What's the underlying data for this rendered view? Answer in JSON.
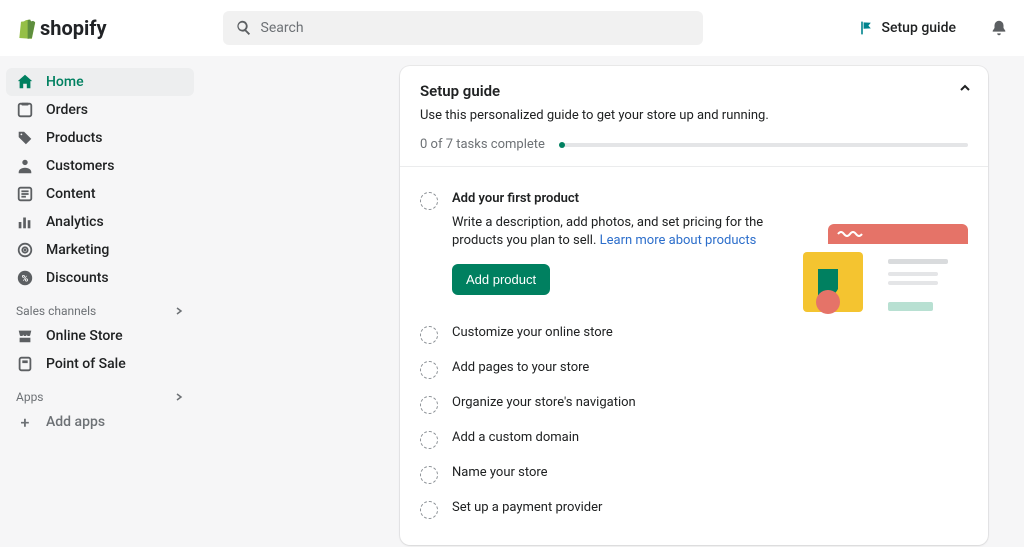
{
  "brand": "shopify",
  "search": {
    "placeholder": "Search"
  },
  "header_actions": {
    "setup_guide": "Setup guide"
  },
  "sidebar": {
    "items": [
      {
        "label": "Home"
      },
      {
        "label": "Orders"
      },
      {
        "label": "Products"
      },
      {
        "label": "Customers"
      },
      {
        "label": "Content"
      },
      {
        "label": "Analytics"
      },
      {
        "label": "Marketing"
      },
      {
        "label": "Discounts"
      }
    ],
    "sales_channels_label": "Sales channels",
    "sales_channels": [
      {
        "label": "Online Store"
      },
      {
        "label": "Point of Sale"
      }
    ],
    "apps_label": "Apps",
    "add_apps": "Add apps"
  },
  "guide": {
    "title": "Setup guide",
    "subtitle": "Use this personalized guide to get your store up and running.",
    "progress_text": "0 of 7 tasks complete",
    "expanded_task": {
      "title": "Add your first product",
      "desc": "Write a description, add photos, and set pricing for the products you plan to sell. ",
      "link": "Learn more about products",
      "button": "Add product"
    },
    "tasks": [
      {
        "title": "Customize your online store"
      },
      {
        "title": "Add pages to your store"
      },
      {
        "title": "Organize your store's navigation"
      },
      {
        "title": "Add a custom domain"
      },
      {
        "title": "Name your store"
      },
      {
        "title": "Set up a payment provider"
      }
    ]
  }
}
